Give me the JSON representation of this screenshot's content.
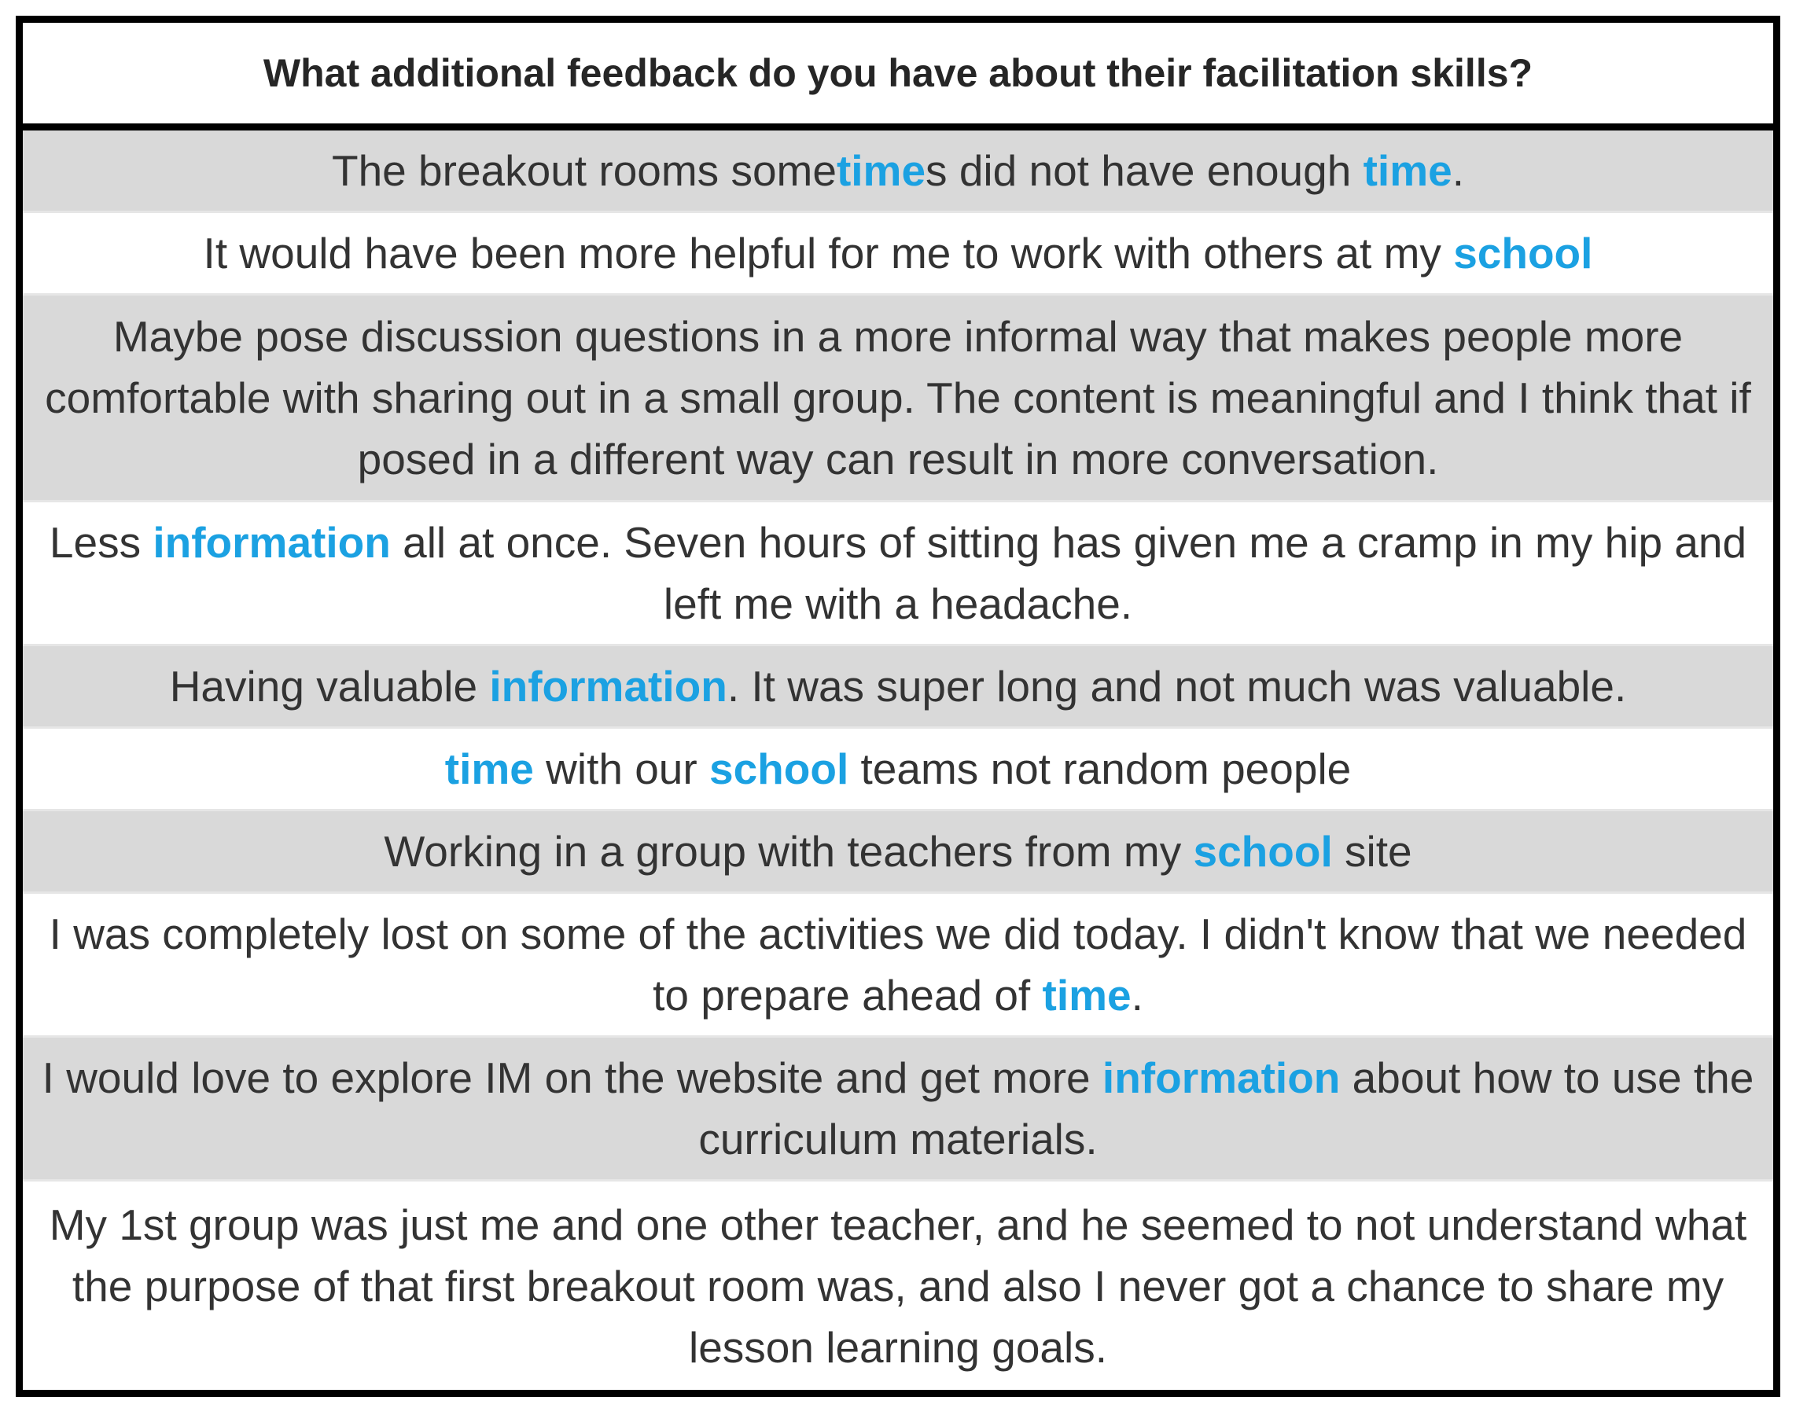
{
  "title": "What additional feedback do you have about their facilitation skills?",
  "highlight_color": "#1ba1e2",
  "row_shading": "#d9d9d9",
  "responses": [
    {
      "parts": [
        {
          "t": "The breakout rooms some"
        },
        {
          "t": "time",
          "hl": true
        },
        {
          "t": "s did not have enough "
        },
        {
          "t": "time",
          "hl": true
        },
        {
          "t": "."
        }
      ]
    },
    {
      "parts": [
        {
          "t": "It would have been more helpful for me to work with others at my "
        },
        {
          "t": "school",
          "hl": true
        }
      ]
    },
    {
      "parts": [
        {
          "t": "Maybe pose discussion questions in a more informal way that makes people more comfortable with sharing out in a small group. The content is meaningful and I think that if posed in a different way can result in more conversation."
        }
      ]
    },
    {
      "parts": [
        {
          "t": "Less "
        },
        {
          "t": "information",
          "hl": true
        },
        {
          "t": " all at once. Seven hours of sitting has given me a cramp in my hip and left me with a headache."
        }
      ]
    },
    {
      "parts": [
        {
          "t": "Having valuable "
        },
        {
          "t": "information",
          "hl": true
        },
        {
          "t": ". It was super long and not much was valuable."
        }
      ]
    },
    {
      "parts": [
        {
          "t": "time",
          "hl": true
        },
        {
          "t": " with our "
        },
        {
          "t": "school",
          "hl": true
        },
        {
          "t": " teams not random people"
        }
      ]
    },
    {
      "parts": [
        {
          "t": "Working in a group with teachers from my "
        },
        {
          "t": "school",
          "hl": true
        },
        {
          "t": " site"
        }
      ]
    },
    {
      "parts": [
        {
          "t": "I was completely lost on some of the activities we did today. I didn't know that we needed to prepare ahead of "
        },
        {
          "t": "time",
          "hl": true
        },
        {
          "t": "."
        }
      ]
    },
    {
      "parts": [
        {
          "t": "I would love to explore IM on the website and get more "
        },
        {
          "t": "information",
          "hl": true
        },
        {
          "t": " about how to use the curriculum materials."
        }
      ]
    },
    {
      "parts": [
        {
          "t": "My 1st group was just me and one other teacher, and he seemed to not understand what the purpose of that first breakout room was, and also I never got a chance to share my lesson learning goals."
        }
      ]
    }
  ]
}
